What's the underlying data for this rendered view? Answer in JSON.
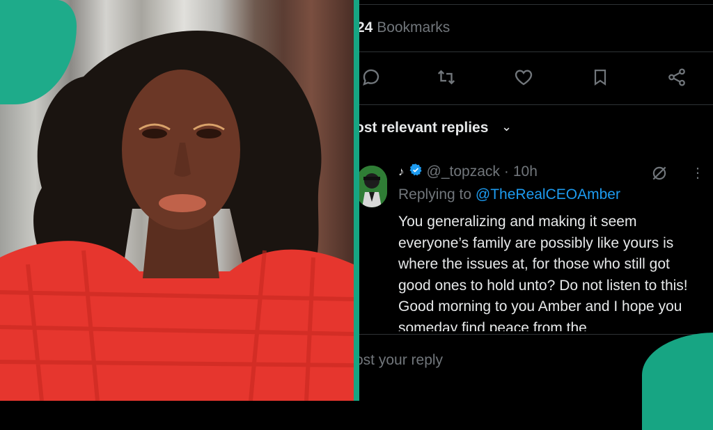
{
  "post": {
    "bookmarks_count": "24",
    "bookmarks_label": " Bookmarks"
  },
  "actions": [
    "reply-icon",
    "repost-icon",
    "like-icon",
    "bookmark-icon",
    "share-icon"
  ],
  "replies": {
    "header": "ost relevant replies",
    "chevron": "⌄"
  },
  "reply": {
    "badge": "♪",
    "handle": "@_topzack",
    "separator": "·",
    "time": "10h",
    "replying_to_label": "Replying to",
    "replying_to_handle": "@TheRealCEOAmber",
    "text": "You generalizing and making it seem everyone’s family are possibly like yours is where the issues at, for those who still got good ones to hold unto? Do not listen to this! Good morning to you Amber and I hope you someday find peace from the",
    "more": "⋮"
  },
  "composer": {
    "placeholder": "ost your reply"
  },
  "colors": {
    "accent": "#17a583",
    "link": "#1d9bf0",
    "muted": "#71767b",
    "text": "#e7e9ea"
  }
}
